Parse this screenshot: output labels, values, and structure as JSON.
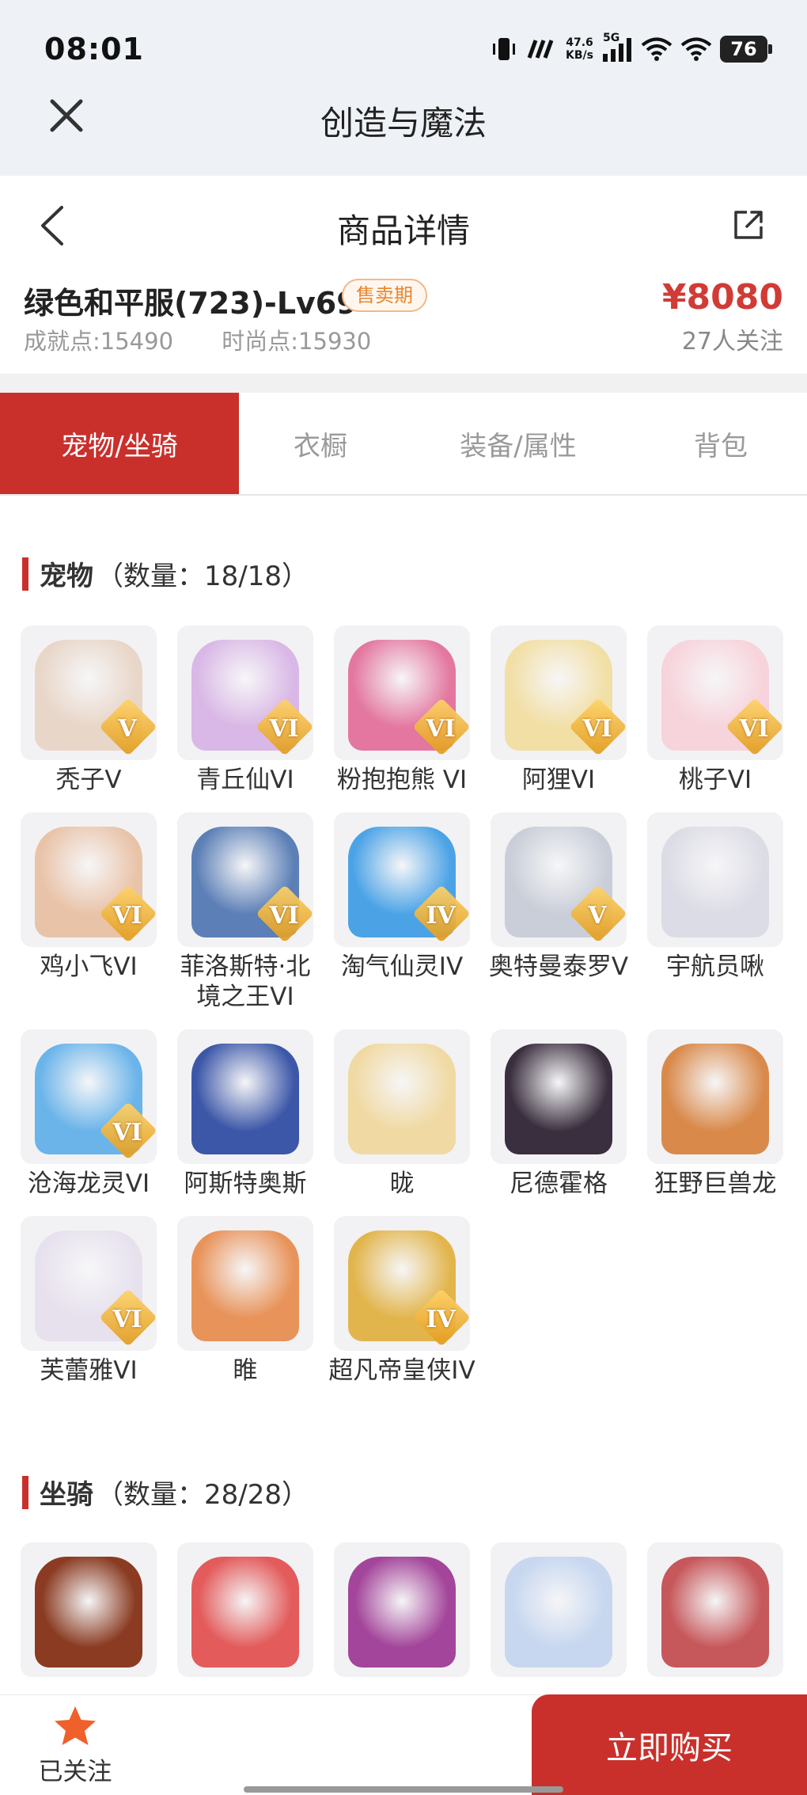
{
  "status_bar": {
    "time": "08:01",
    "net_speed_value": "47.6",
    "net_speed_unit": "KB/s",
    "signal_label": "5G",
    "battery": "76"
  },
  "app_bar": {
    "title": "创造与魔法"
  },
  "header": {
    "title": "商品详情"
  },
  "item": {
    "name": "绿色和平服(723)-Lv69",
    "badge": "售卖期",
    "achievement_label": "成就点:",
    "achievement_value": "15490",
    "fashion_label": "时尚点:",
    "fashion_value": "15930",
    "price": "¥8080",
    "followers": "27人关注"
  },
  "tabs": [
    {
      "label": "宠物/坐骑",
      "active": true
    },
    {
      "label": "衣橱",
      "active": false
    },
    {
      "label": "装备/属性",
      "active": false
    },
    {
      "label": "背包",
      "active": false
    }
  ],
  "pets_section": {
    "title": "宠物",
    "count": "（数量：18/18）"
  },
  "pets": [
    {
      "name": "秃子V",
      "grade": "V",
      "color": "#e8d6c8"
    },
    {
      "name": "青丘仙VI",
      "grade": "VI",
      "color": "#d9b7e6"
    },
    {
      "name": "粉抱抱熊 VI",
      "grade": "VI",
      "color": "#e3779f"
    },
    {
      "name": "阿狸VI",
      "grade": "VI",
      "color": "#f2dfa5"
    },
    {
      "name": "桃子VI",
      "grade": "VI",
      "color": "#f7d3db"
    },
    {
      "name": "鸡小飞VI",
      "grade": "VI",
      "color": "#e9c3a8"
    },
    {
      "name": "菲洛斯特·北境之王VI",
      "grade": "VI",
      "color": "#5b7fb6"
    },
    {
      "name": "淘气仙灵IV",
      "grade": "IV",
      "color": "#4ba3e6"
    },
    {
      "name": "奥特曼泰罗V",
      "grade": "V",
      "color": "#c9ced8"
    },
    {
      "name": "宇航员啾",
      "grade": "",
      "color": "#dcdce6"
    },
    {
      "name": "沧海龙灵VI",
      "grade": "VI",
      "color": "#6ab4ea"
    },
    {
      "name": "阿斯特奥斯",
      "grade": "",
      "color": "#3c57a8"
    },
    {
      "name": "昽",
      "grade": "",
      "color": "#f0d9a2"
    },
    {
      "name": "尼德霍格",
      "grade": "",
      "color": "#3a2f3e"
    },
    {
      "name": "狂野巨兽龙",
      "grade": "",
      "color": "#d98a4b"
    },
    {
      "name": "芙蕾雅VI",
      "grade": "VI",
      "color": "#e7e1ee"
    },
    {
      "name": "睢",
      "grade": "",
      "color": "#e8935a"
    },
    {
      "name": "超凡帝皇侠IV",
      "grade": "IV",
      "color": "#e2b54c"
    }
  ],
  "mounts_section": {
    "title": "坐骑",
    "count": "（数量：28/28）"
  },
  "mounts": [
    {
      "color": "#8a3b22"
    },
    {
      "color": "#e35b5b"
    },
    {
      "color": "#a3459a"
    },
    {
      "color": "#c7d7f0"
    },
    {
      "color": "#c6575a"
    }
  ],
  "bottom": {
    "follow_label": "已关注",
    "buy_label": "立即购买"
  },
  "colors": {
    "accent": "#c9302c",
    "price": "#d13b36",
    "badge": "#e7872f"
  }
}
